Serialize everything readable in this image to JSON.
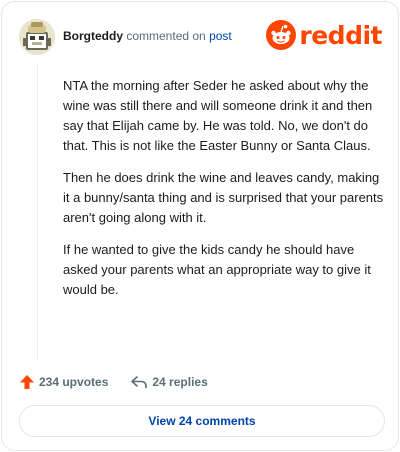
{
  "header": {
    "username": "Borgteddy",
    "commented_text": "commented on",
    "post_link": "post",
    "logo_text": "reddit"
  },
  "comment": {
    "paragraphs": [
      "NTA the morning after Seder he asked about why the wine was still there and will someone drink it and then say that Elijah came by. He was told. No, we don't do that. This is not like the Easter Bunny or Santa Claus.",
      "Then he does drink the wine and leaves candy, making it a bunny/santa thing and is surprised that your parents aren't going along with it.",
      "If he wanted to give the kids candy he should have asked your parents what an appropriate way to give it would be."
    ]
  },
  "actions": {
    "upvotes": "234 upvotes",
    "replies": "24 replies"
  },
  "footer": {
    "view_comments": "View 24 comments"
  },
  "colors": {
    "accent": "#ff4500",
    "link": "#0045ac",
    "muted": "#576f76"
  }
}
